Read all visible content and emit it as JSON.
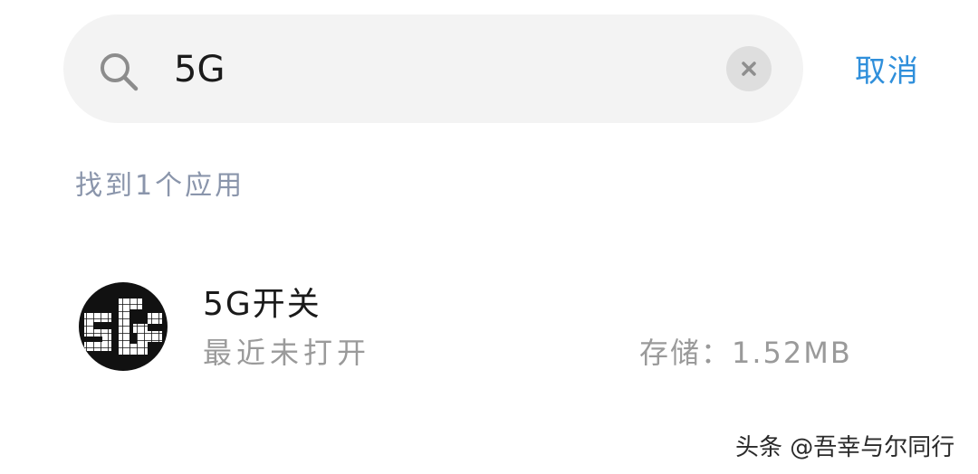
{
  "search": {
    "icon": "search-icon",
    "value": "5G",
    "clear_icon": "close-icon",
    "cancel_label": "取消"
  },
  "results": {
    "count_label": "找到1个应用",
    "apps": [
      {
        "icon": "5g-app-icon",
        "name": "5G开关",
        "status": "最近未打开",
        "storage": "存储：1.52MB"
      }
    ]
  },
  "watermark": "头条 @吾幸与尔同行",
  "colors": {
    "accent": "#2f8fdb",
    "search_bg": "#f3f3f3",
    "secondary_text": "#9a9a9a",
    "section_label": "#8a95ab"
  }
}
